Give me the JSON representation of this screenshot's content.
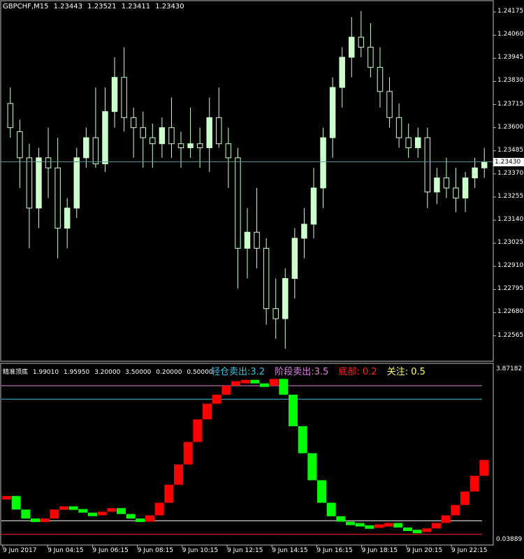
{
  "window": {
    "symbol": "GBPCHF,M15",
    "ohlc": [
      "1.23443",
      "1.23521",
      "1.23411",
      "1.23430"
    ]
  },
  "price_axis": {
    "ticks": [
      "1.24175",
      "1.24060",
      "1.23945",
      "1.23830",
      "1.23715",
      "1.23600",
      "1.23485",
      "1.23370",
      "1.23255",
      "1.23140",
      "1.23025",
      "1.22910",
      "1.22795",
      "1.22680",
      "1.22565"
    ],
    "current_price": "1.23430"
  },
  "indicator": {
    "name": "精准顶底",
    "params": [
      "1.99010",
      "1.95950",
      "3.20000",
      "3.50000",
      "0.20000",
      "0.50000"
    ],
    "axis_top": "3.87182",
    "axis_bottom": "0.03889",
    "legend": [
      {
        "text": "轻仓卖出:3.2",
        "color": "#40c0e0"
      },
      {
        "text": "阶段卖出:3.5",
        "color": "#e080e0"
      },
      {
        "text": "底部: 0.2",
        "color": "#ff2020"
      },
      {
        "text": "关注: 0.5",
        "color": "#ffff60"
      }
    ]
  },
  "time_axis": {
    "labels": [
      "9 Jun 2017",
      "9 Jun 04:15",
      "9 Jun 06:15",
      "9 Jun 08:15",
      "9 Jun 10:15",
      "9 Jun 12:15",
      "9 Jun 14:15",
      "9 Jun 16:15",
      "9 Jun 18:15",
      "9 Jun 20:15",
      "9 Jun 22:15"
    ]
  },
  "colors": {
    "background": "#000000",
    "candle_up": "#ccffcc",
    "bar_up": "#ff0000",
    "bar_down": "#00ff00",
    "grid_line": "#5a9a9a"
  },
  "chart_data": [
    {
      "type": "candlestick",
      "ylim": [
        1.2248,
        1.242
      ],
      "candles": [
        [
          1.2372,
          1.238,
          1.2355,
          1.236
        ],
        [
          1.2358,
          1.2364,
          1.233,
          1.2345
        ],
        [
          1.2345,
          1.2352,
          1.23,
          1.232
        ],
        [
          1.232,
          1.235,
          1.231,
          1.2345
        ],
        [
          1.2345,
          1.236,
          1.2325,
          1.234
        ],
        [
          1.234,
          1.2355,
          1.2295,
          1.231
        ],
        [
          1.231,
          1.2325,
          1.23,
          1.232
        ],
        [
          1.232,
          1.235,
          1.2315,
          1.2345
        ],
        [
          1.2345,
          1.236,
          1.234,
          1.2355
        ],
        [
          1.2355,
          1.238,
          1.234,
          1.2342
        ],
        [
          1.2342,
          1.238,
          1.2338,
          1.2368
        ],
        [
          1.2368,
          1.2395,
          1.236,
          1.2385
        ],
        [
          1.2385,
          1.24,
          1.2358,
          1.2365
        ],
        [
          1.2365,
          1.237,
          1.2345,
          1.236
        ],
        [
          1.236,
          1.2368,
          1.234,
          1.2355
        ],
        [
          1.2355,
          1.2362,
          1.234,
          1.2352
        ],
        [
          1.2352,
          1.2365,
          1.2345,
          1.236
        ],
        [
          1.236,
          1.2375,
          1.2345,
          1.2352
        ],
        [
          1.2352,
          1.2358,
          1.234,
          1.235
        ],
        [
          1.235,
          1.237,
          1.2345,
          1.2352
        ],
        [
          1.2352,
          1.236,
          1.234,
          1.235
        ],
        [
          1.235,
          1.2375,
          1.2338,
          1.2365
        ],
        [
          1.2365,
          1.238,
          1.235,
          1.2352
        ],
        [
          1.2352,
          1.236,
          1.233,
          1.2345
        ],
        [
          1.2345,
          1.235,
          1.228,
          1.23
        ],
        [
          1.23,
          1.232,
          1.2285,
          1.2308
        ],
        [
          1.2308,
          1.233,
          1.229,
          1.23
        ],
        [
          1.23,
          1.2305,
          1.2262,
          1.227
        ],
        [
          1.227,
          1.2285,
          1.2255,
          1.2265
        ],
        [
          1.2265,
          1.229,
          1.225,
          1.2285
        ],
        [
          1.2285,
          1.231,
          1.2275,
          1.2305
        ],
        [
          1.2305,
          1.232,
          1.2295,
          1.2312
        ],
        [
          1.2312,
          1.234,
          1.2305,
          1.233
        ],
        [
          1.233,
          1.236,
          1.232,
          1.2355
        ],
        [
          1.2355,
          1.2385,
          1.2345,
          1.238
        ],
        [
          1.238,
          1.24,
          1.237,
          1.2395
        ],
        [
          1.2395,
          1.2415,
          1.2385,
          1.2405
        ],
        [
          1.2405,
          1.2418,
          1.2395,
          1.24
        ],
        [
          1.24,
          1.2412,
          1.2385,
          1.239
        ],
        [
          1.239,
          1.24,
          1.237,
          1.2378
        ],
        [
          1.2378,
          1.2385,
          1.236,
          1.2365
        ],
        [
          1.2365,
          1.2372,
          1.235,
          1.2355
        ],
        [
          1.2355,
          1.2362,
          1.2345,
          1.235
        ],
        [
          1.235,
          1.236,
          1.2345,
          1.2355
        ],
        [
          1.2355,
          1.236,
          1.232,
          1.2328
        ],
        [
          1.2328,
          1.234,
          1.2322,
          1.2335
        ],
        [
          1.2335,
          1.2345,
          1.2325,
          1.233
        ],
        [
          1.233,
          1.234,
          1.2318,
          1.2325
        ],
        [
          1.2325,
          1.2338,
          1.2318,
          1.2335
        ],
        [
          1.2335,
          1.2345,
          1.233,
          1.234
        ],
        [
          1.234,
          1.235,
          1.2335,
          1.2343
        ]
      ]
    },
    {
      "type": "bar",
      "ylim": [
        0.03889,
        3.87182
      ],
      "reference_lines": [
        {
          "name": "阶段卖出",
          "value": 3.5
        },
        {
          "name": "轻仓卖出",
          "value": 3.2
        },
        {
          "name": "关注",
          "value": 0.5
        },
        {
          "name": "底部",
          "value": 0.2
        }
      ],
      "values": [
        1.05,
        0.75,
        0.55,
        0.5,
        0.55,
        0.75,
        0.82,
        0.76,
        0.68,
        0.65,
        0.7,
        0.78,
        0.65,
        0.55,
        0.48,
        0.62,
        0.9,
        1.3,
        1.75,
        2.25,
        2.75,
        3.1,
        3.3,
        3.5,
        3.6,
        3.63,
        3.55,
        3.5,
        3.65,
        3.3,
        2.6,
        2.0,
        1.4,
        0.9,
        0.6,
        0.48,
        0.45,
        0.4,
        0.38,
        0.42,
        0.45,
        0.35,
        0.3,
        0.25,
        0.33,
        0.45,
        0.62,
        0.85,
        1.15,
        1.5,
        1.85
      ]
    }
  ]
}
